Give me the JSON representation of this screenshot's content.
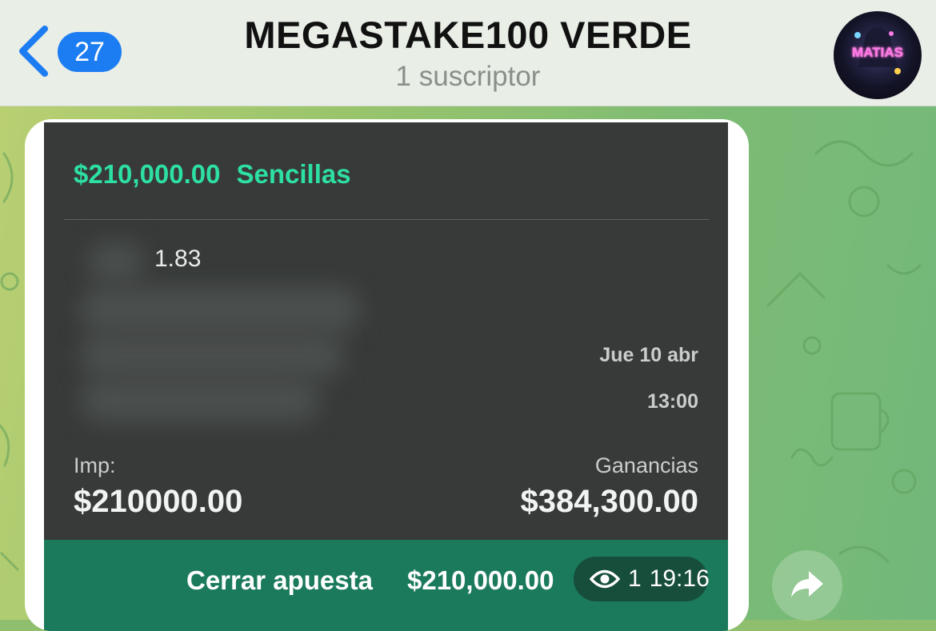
{
  "header": {
    "back_count": "27",
    "title": "MEGASTAKE100 VERDE",
    "subtitle": "1 suscriptor",
    "avatar_text": "MATIAS"
  },
  "bet": {
    "amount": "$210,000.00",
    "type": "Sencillas",
    "odds": "1.83",
    "date": "Jue 10 abr",
    "time": "13:00",
    "stake_label": "Imp:",
    "stake_value": "$210000.00",
    "winnings_label": "Ganancias",
    "winnings_value": "$384,300.00",
    "cashout_label": "Cerrar apuesta",
    "cashout_amount": "$210,000.00"
  },
  "message": {
    "views": "1",
    "time": "19:16"
  },
  "colors": {
    "accent_green": "#2de0a2",
    "cashout_green": "#1b7a5c",
    "badge_blue": "#1c7cf2",
    "card_bg": "#373a39"
  },
  "icons": {
    "back": "chevron-left-icon",
    "views": "eye-icon",
    "forward": "share-arrow-icon"
  }
}
